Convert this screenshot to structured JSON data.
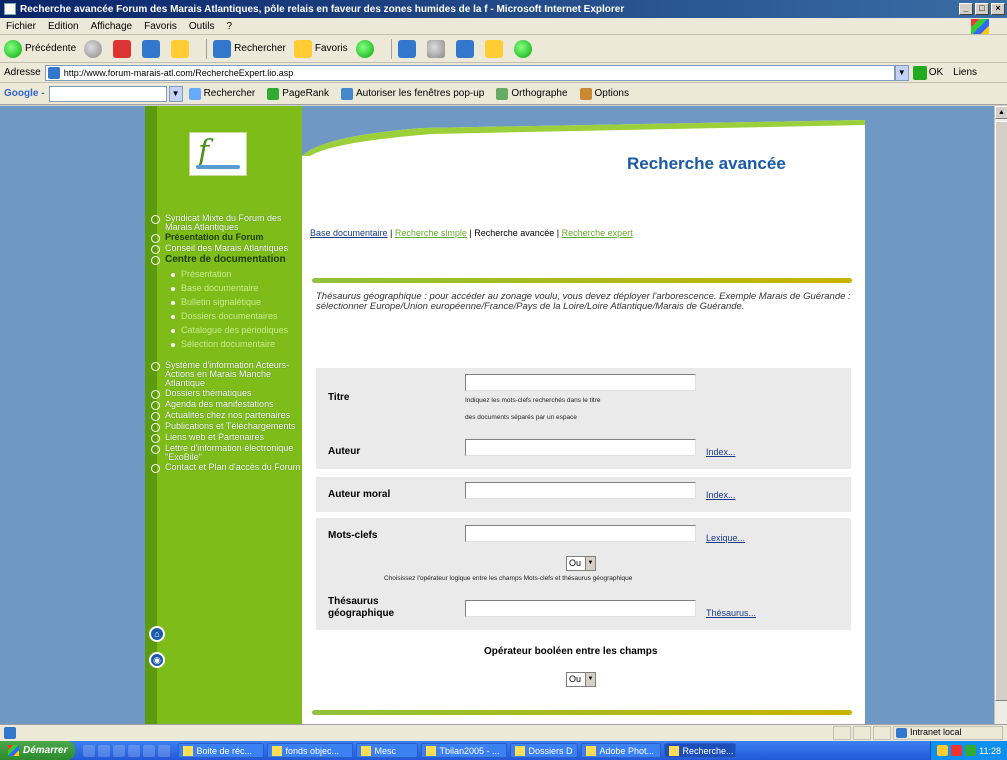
{
  "window": {
    "title": "Recherche avancée Forum des Marais Atlantiques, pôle relais en faveur des zones humides de la f - Microsoft Internet Explorer",
    "min": "_",
    "max": "□",
    "close": "×"
  },
  "menu": [
    "Fichier",
    "Edition",
    "Affichage",
    "Favoris",
    "Outils",
    "?"
  ],
  "toolbar": {
    "back": "Précédente",
    "search": "Rechercher",
    "favorites": "Favoris"
  },
  "address": {
    "label": "Adresse",
    "url": "http://www.forum-marais-atl.com/RechercheExpert.lio.asp",
    "go": "OK",
    "links": "Liens"
  },
  "googlebar": {
    "logo": "Google -",
    "search": "Rechercher",
    "pagerank": "PageRank",
    "popups": "Autoriser les fenêtres pop-up",
    "spell": "Orthographe",
    "options": "Options"
  },
  "nav": {
    "items": [
      "Syndicat Mixte du Forum des Marais Atlantiques",
      "Présentation du Forum",
      "Conseil des Marais Atlantiques",
      "Centre de documentation"
    ],
    "subitems": [
      "Présentation",
      "Base documentaire",
      "Bulletin signalétique",
      "Dossiers documentaires",
      "Catalogue des périodiques",
      "Sélection documentaire"
    ],
    "items2": [
      "Système d'information Acteurs-Actions en Marais Manche Atlantique",
      "Dossiers thématiques",
      "Agenda des manifestations",
      "Actualités chez nos partenaires",
      "Publications et Téléchargements",
      "Liens web et Partenaires",
      "Lettre d'information électronique \"ExoBile\"",
      "Contact et Plan d'accès du Forum"
    ]
  },
  "page": {
    "title": "Recherche avancée",
    "breadcrumb": {
      "base": "Base documentaire",
      "sep1": " | ",
      "simple": "Recherche simple",
      "sep2": " | Recherche avancée | ",
      "expert": "Recherche expert"
    },
    "intro": "Thésaurus géographique : pour accéder au zonage voulu, vous devez déployer l'arborescence. Exemple Marais de Guérande : sélectionner Europe/Union européenne/France/Pays de la Loire/Loire Atlantique/Marais de Guérande.",
    "fields": {
      "titre": "Titre",
      "titre_hint1": "Indiquez les mots-clefs recherchés dans le titre",
      "titre_hint2": "des documents séparés par un espace",
      "auteur": "Auteur",
      "auteur_link": "Index...",
      "auteur_moral": "Auteur moral",
      "auteur_moral_link": "Index...",
      "mots_clefs": "Mots-clefs",
      "mots_clefs_link": "Lexique...",
      "operator": "Ou",
      "operator_hint": "Choisissez l'opérateur logique entre les champs Mots-clefs et thésaurus géographique",
      "thesaurus": "Thésaurus géographique",
      "thesaurus_link": "Thésaurus...",
      "bool_label": "Opérateur booléen entre les champs",
      "bool_value": "Ou"
    }
  },
  "status": {
    "zone": "Intranet local"
  },
  "taskbar": {
    "start": "Démarrer",
    "tasks": [
      "Boite de réc...",
      "fonds objec...",
      "Mesc",
      "Tbilan2005 - ...",
      "Dossiers D",
      "Adobe Phot...",
      "Recherche..."
    ],
    "clock": "11:28"
  }
}
